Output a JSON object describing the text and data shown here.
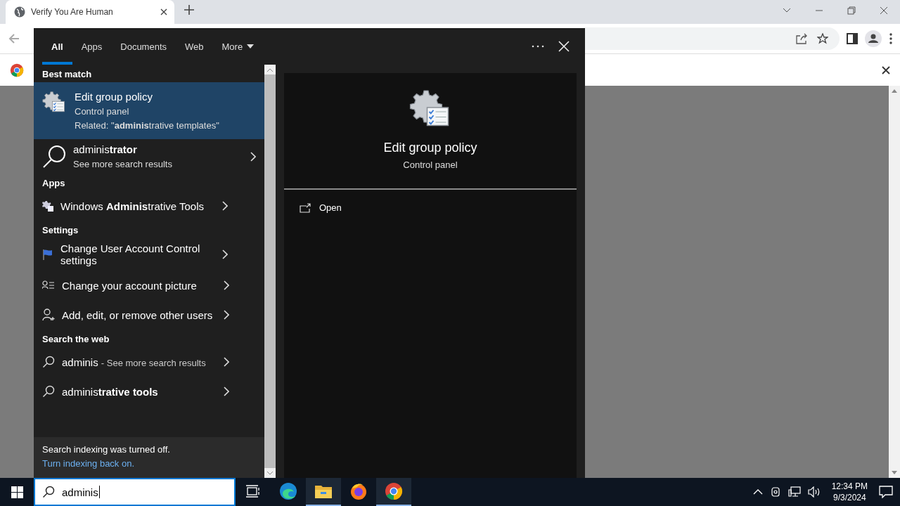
{
  "browser": {
    "tab": {
      "title": "Verify You Are Human"
    }
  },
  "search_panel": {
    "tabs": [
      {
        "label": "All",
        "selected": true
      },
      {
        "label": "Apps",
        "selected": false
      },
      {
        "label": "Documents",
        "selected": false
      },
      {
        "label": "Web",
        "selected": false
      },
      {
        "label": "More",
        "selected": false,
        "kind": "menu"
      }
    ],
    "sections": [
      {
        "heading": "Best match",
        "items": [
          {
            "kind": "best",
            "title": "Edit group policy",
            "subtitle": "Control panel",
            "related": "Related: \"**adminis**trative templates\"",
            "selected": true
          },
          {
            "kind": "search",
            "title": "adminis**trator**",
            "subtitle": "See more search results",
            "selected": false
          }
        ]
      },
      {
        "heading": "Apps",
        "items": [
          {
            "kind": "row",
            "title": "Windows **Adminis**trative Tools",
            "selected": false
          }
        ]
      },
      {
        "heading": "Settings",
        "items": [
          {
            "kind": "row",
            "title": "Change User Account Control settings",
            "selected": false
          },
          {
            "kind": "row",
            "title": "Change your account picture",
            "selected": false
          },
          {
            "kind": "row",
            "title": "Add, edit, or remove other users",
            "selected": false
          }
        ]
      },
      {
        "heading": "Search the web",
        "items": [
          {
            "kind": "web",
            "title": "adminis",
            "note": "- See more search results",
            "selected": false
          },
          {
            "kind": "row",
            "title": "adminis**trative tools**",
            "selected": false
          }
        ]
      }
    ],
    "notice": {
      "text": "Search indexing was turned off.",
      "link": "Turn indexing back on."
    },
    "preview": {
      "title": "Edit group policy",
      "subtitle": "Control panel",
      "actions": [
        {
          "label": "Open"
        }
      ]
    }
  },
  "taskbar": {
    "search": {
      "value": "adminis"
    },
    "apps": [
      {
        "kind": "edge",
        "running": false
      },
      {
        "kind": "explorer",
        "running": true
      },
      {
        "kind": "firefox",
        "running": false
      },
      {
        "kind": "chrome",
        "running": true
      }
    ],
    "clock": {
      "time": "12:34 PM",
      "date": "9/3/2024"
    }
  }
}
